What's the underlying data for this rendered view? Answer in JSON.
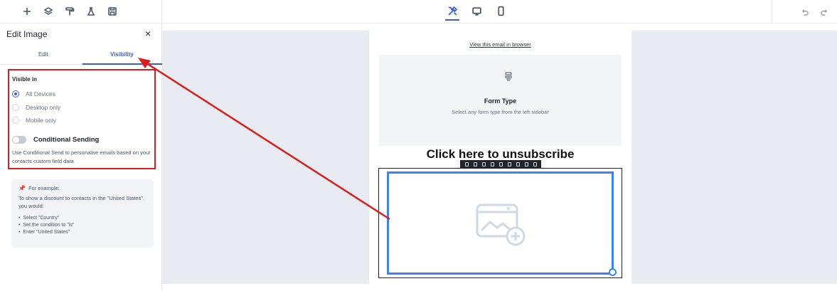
{
  "toolbar": {
    "left_icons": [
      "plus-icon",
      "layers-icon",
      "paint-roller-icon",
      "flask-icon",
      "save-icon"
    ],
    "view_icons": [
      "tools-icon",
      "desktop-icon",
      "mobile-icon"
    ],
    "history_icons": [
      "undo-icon",
      "redo-icon"
    ]
  },
  "panel": {
    "title": "Edit Image",
    "close_label": "×",
    "tabs": [
      {
        "label": "Edit"
      },
      {
        "label": "Visibility"
      }
    ],
    "visible_in_title": "Visible in",
    "options": [
      {
        "label": "All Devices",
        "selected": true
      },
      {
        "label": "Desktop only",
        "selected": false
      },
      {
        "label": "Mobile only",
        "selected": false
      }
    ],
    "conditional_label": "Conditional Sending",
    "conditional_desc": "Use Conditional Send to personalise emails based on your contacts custom field data",
    "example": {
      "pin_icon": "📌",
      "heading": "For example:",
      "desc": "To show a discount to contacts in the \"United States\", you would:",
      "steps": [
        "Select \"Country\"",
        "Set the condition to \"is\"",
        "Enter \"United States\""
      ]
    }
  },
  "email": {
    "view_in_browser": "View this email in browser",
    "form_title": "Form Type",
    "form_subtitle": "Select any form type from the left sidebar",
    "unsubscribe": "Click here to unsubscribe"
  },
  "colors": {
    "accent": "#3b5bdb",
    "annotation": "#d91e1e",
    "image_selection": "#3b82f6",
    "canvas_bg": "#e8ebf1"
  }
}
